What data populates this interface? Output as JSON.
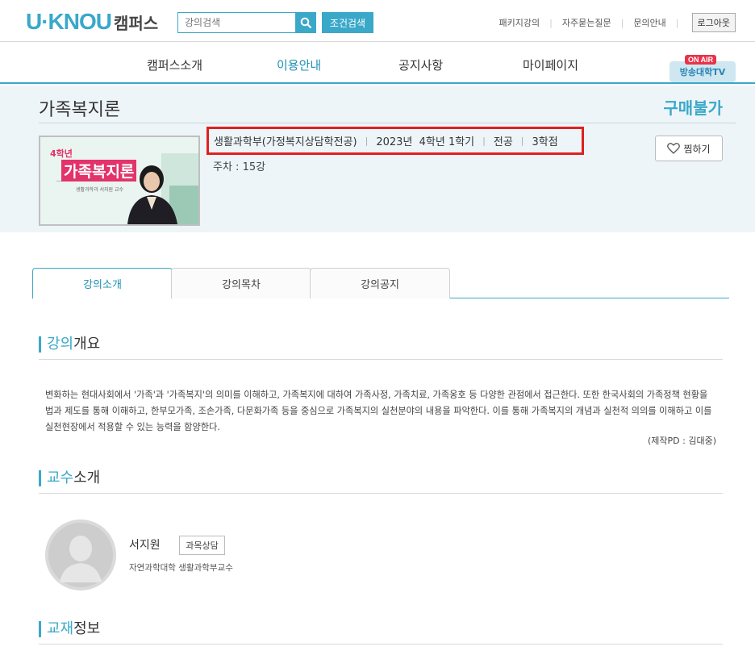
{
  "header": {
    "logo_main": "U·KNOU",
    "logo_sub": "캠퍼스",
    "search_placeholder": "강의검색",
    "advanced_search_label": "조건검색",
    "util_links": [
      "패키지강의",
      "자주묻는질문",
      "문의안내"
    ],
    "logout_label": "로그아웃"
  },
  "gnb": {
    "items": [
      "캠퍼스소개",
      "이용안내",
      "공지사항",
      "마이페이지"
    ],
    "active_index": 1,
    "onair_tag": "ON AIR",
    "onair_label": "방송대학TV"
  },
  "course": {
    "title": "가족복지론",
    "purchase_status": "구매불가",
    "thumbnail_grade": "4학년",
    "thumbnail_title": "가족복지론",
    "thumbnail_caption": "생활과학과 서지원 교수",
    "department": "생활과학부(가정복지상담학전공)",
    "term": "2023년  4학년 1학기",
    "category": "전공",
    "credits": "3학점",
    "weeks": "주차 : 15강",
    "wish_label": "찜하기"
  },
  "tabs": {
    "items": [
      "강의소개",
      "강의목차",
      "강의공지"
    ],
    "active_index": 0
  },
  "overview": {
    "heading_hl": "강의",
    "heading_rest": "개요",
    "body": "변화하는 현대사회에서 '가족'과 '가족복지'의 의미를 이해하고, 가족복지에 대하여 가족사정, 가족치료, 가족옹호 등 다양한 관점에서 접근한다. 또한 한국사회의 가족정책 현황을 법과 제도를 통해 이해하고, 한부모가족, 조손가족, 다문화가족 등을 중심으로 가족복지의 실천분야의 내용을 파악한다. 이를 통해 가족복지의 개념과 실천적 의의를 이해하고 이를 실천현장에서 적용할 수 있는 능력을 함양한다.",
    "producer": "(제작PD : 김대중)"
  },
  "professor": {
    "heading_hl": "교수",
    "heading_rest": "소개",
    "name": "서지원",
    "consult_label": "과목상담",
    "department": "자연과학대학 생활과학부교수"
  },
  "textbook": {
    "heading_hl": "교재",
    "heading_rest": "정보"
  },
  "colors": {
    "accent": "#3aa8c9",
    "highlight_border": "#e02020",
    "summary_bg": "#eef5f8"
  }
}
